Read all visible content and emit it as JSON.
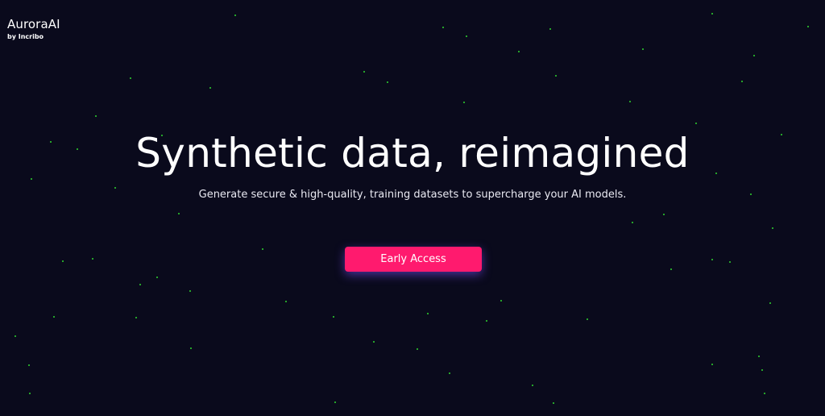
{
  "brand": {
    "name": "AuroraAI",
    "byline": "by Incribo"
  },
  "hero": {
    "title": "Synthetic data, reimagined",
    "subtitle": "Generate secure & high-quality, training datasets to supercharge your AI models."
  },
  "cta": {
    "label": "Early Access"
  },
  "colors": {
    "background": "#0a0a1c",
    "accent": "#ff1a6e",
    "star": "#2fd62f"
  }
}
